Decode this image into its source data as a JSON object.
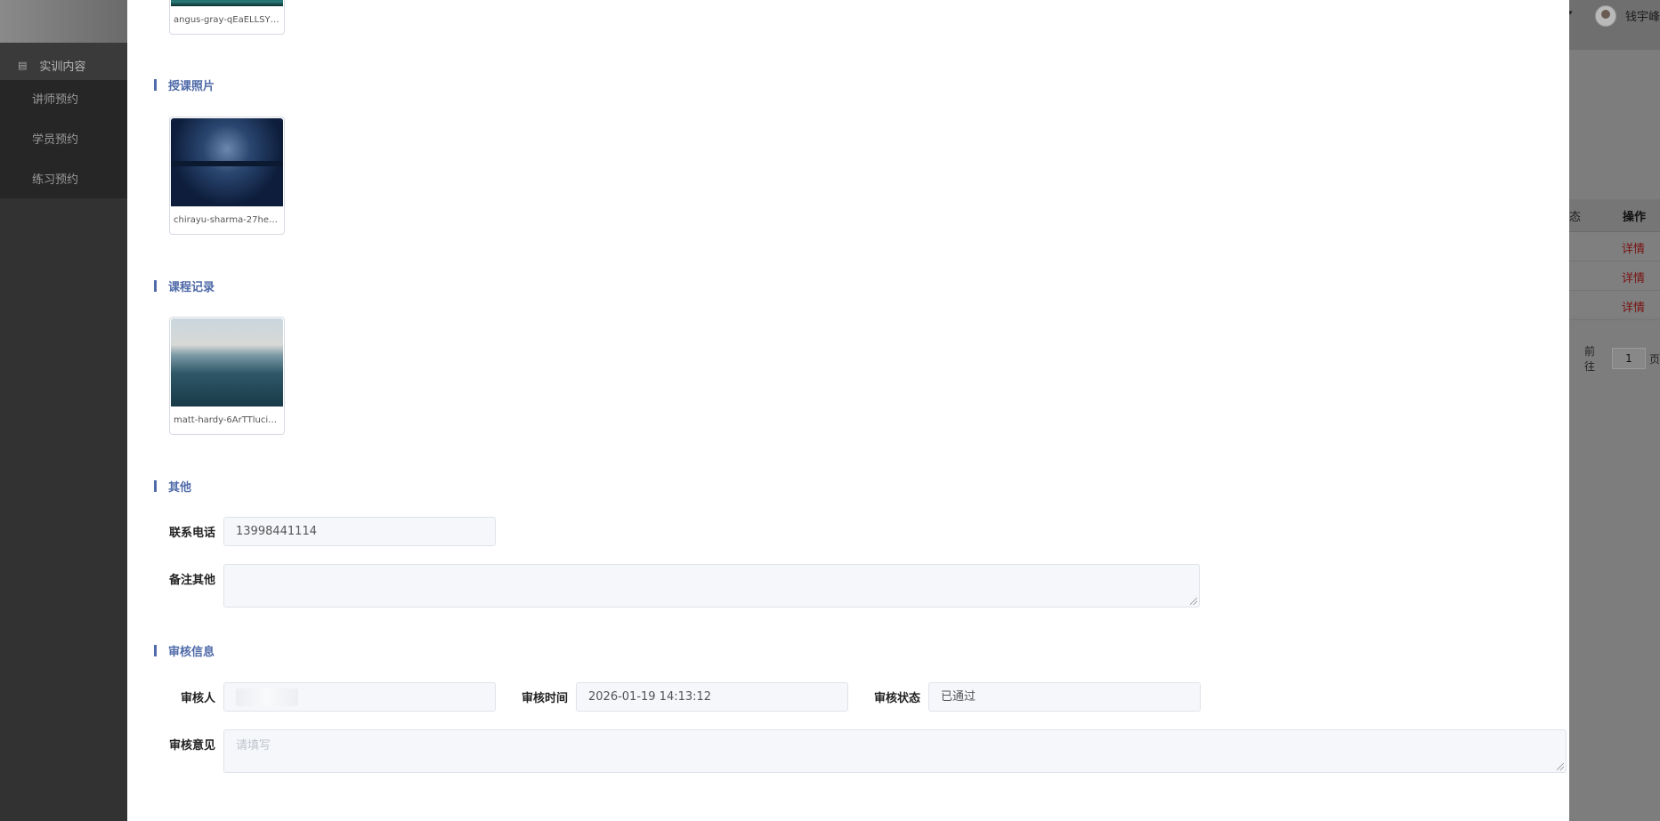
{
  "sidebar": {
    "group": {
      "icon": "menu-icon",
      "label": "实训内容"
    },
    "items": [
      {
        "label": "讲师预约"
      },
      {
        "label": "学员预约"
      },
      {
        "label": "练习预约"
      }
    ]
  },
  "header": {
    "username": "钱宇峰",
    "caret": "▾"
  },
  "background_table": {
    "header_col0": "态",
    "header_col1": "操作",
    "rows": [
      {
        "action": "详情"
      },
      {
        "action": "详情"
      },
      {
        "action": "详情"
      }
    ],
    "pager": {
      "goto_label": "前往",
      "page": "1",
      "page_suffix": "页"
    }
  },
  "panel": {
    "top_attachment": {
      "filename": "angus-gray-qEaELLSYZ..."
    },
    "teaching_photos": {
      "title": "授课照片",
      "attachments": [
        {
          "filename": "chirayu-sharma-27heHQl..."
        }
      ]
    },
    "course_records": {
      "title": "课程记录",
      "attachments": [
        {
          "filename": "matt-hardy-6ArTTluciuA-..."
        }
      ]
    },
    "other": {
      "title": "其他",
      "phone_label": "联系电话",
      "phone_value": "13998441114",
      "remarks_label": "备注其他",
      "remarks_value": ""
    },
    "review": {
      "title": "审核信息",
      "reviewer_label": "审核人",
      "reviewer_value": "",
      "time_label": "审核时间",
      "time_value": "2026-01-19 14:13:12",
      "status_label": "审核状态",
      "status_value": "已通过",
      "opinion_label": "审核意见",
      "opinion_placeholder": "请填写"
    }
  }
}
